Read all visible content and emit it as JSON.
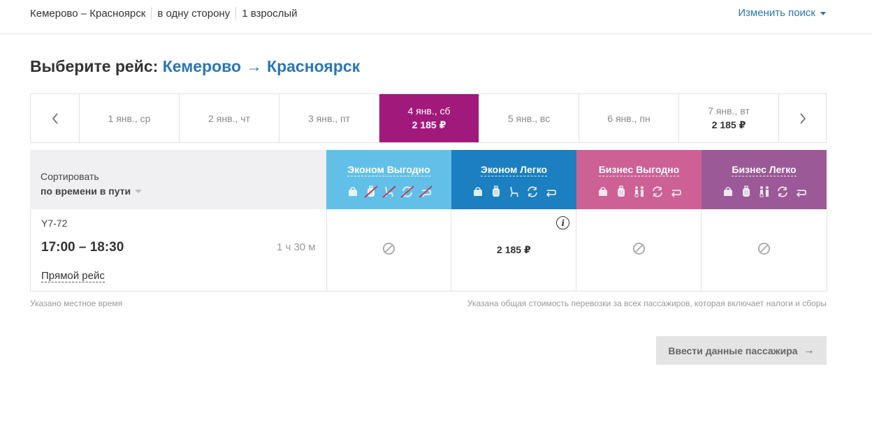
{
  "topbar": {
    "route": "Кемерово – Красноярск",
    "trip_type": "в одну сторону",
    "passengers": "1 взрослый",
    "change_search": "Изменить поиск"
  },
  "title": {
    "prefix": "Выберите рейс:",
    "from": "Кемерово",
    "arrow": "→",
    "to": "Красноярск"
  },
  "dates": [
    {
      "label": "1 янв., ср",
      "price": ""
    },
    {
      "label": "2 янв., чт",
      "price": ""
    },
    {
      "label": "3 янв., пт",
      "price": ""
    },
    {
      "label": "4 янв., сб",
      "price": "2 185 ₽",
      "active": true
    },
    {
      "label": "5 янв., вс",
      "price": ""
    },
    {
      "label": "6 янв., пн",
      "price": ""
    },
    {
      "label": "7 янв., вт",
      "price": "2 185 ₽"
    }
  ],
  "sort": {
    "label": "Сортировать",
    "value": "по времени в пути"
  },
  "fares": [
    {
      "name": "Эконом Выгодно",
      "color": "#62c0e8",
      "icons": [
        "bag-icon",
        "suitcase-crossed-icon",
        "seat-crossed-icon",
        "exchange-crossed-icon",
        "refund-crossed-icon"
      ]
    },
    {
      "name": "Эконом Легко",
      "color": "#1b7fc1",
      "icons": [
        "bag-icon",
        "suitcase-icon",
        "seat-icon",
        "exchange-icon",
        "refund-icon"
      ]
    },
    {
      "name": "Бизнес Выгодно",
      "color": "#cd6196",
      "icons": [
        "bag-icon",
        "suitcase-icon",
        "priority-icon",
        "exchange-icon",
        "refund-icon"
      ]
    },
    {
      "name": "Бизнес Легко",
      "color": "#9b5997",
      "icons": [
        "bag-icon",
        "suitcase-icon",
        "priority-icon",
        "exchange-icon",
        "refund-icon"
      ]
    }
  ],
  "flight": {
    "number": "Y7-72",
    "time": "17:00 – 18:30",
    "duration": "1 ч 30 м",
    "type": "Прямой рейс",
    "prices": [
      "",
      "2 185 ₽",
      "",
      ""
    ]
  },
  "notes": {
    "left": "Указано местное время",
    "right": "Указана общая стоимость перевозки за всех пассажиров, которая включает налоги и сборы"
  },
  "next_button": {
    "label": "Ввести данные пассажира",
    "arrow": "→"
  }
}
